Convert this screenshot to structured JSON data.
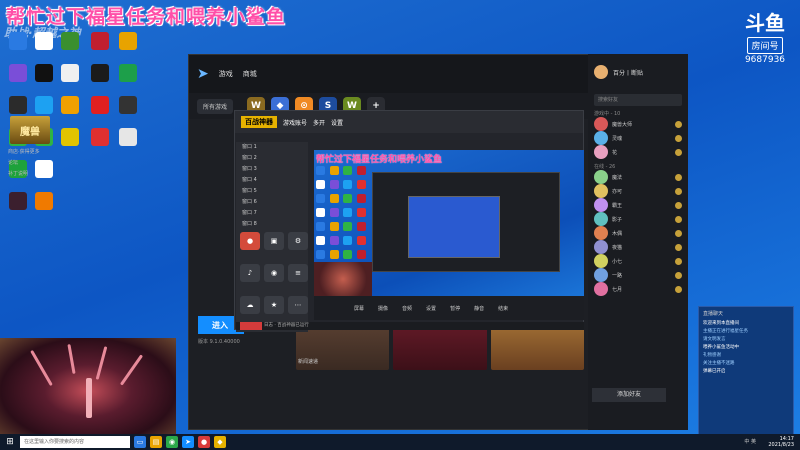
{
  "overlay": {
    "title": "帮忙过下福星任务和喂养小鲨鱼",
    "watermark": "助战·超越之神",
    "platform_logo": "斗鱼",
    "room_label": "房间号",
    "room_number": "9687936"
  },
  "desktop_icons": [
    {
      "name": "icon-1",
      "color": "#2a7ae2"
    },
    {
      "name": "icon-2",
      "color": "#ffffff"
    },
    {
      "name": "icon-3",
      "color": "#3a8f2f"
    },
    {
      "name": "icon-4",
      "color": "#c01f2f"
    },
    {
      "name": "icon-5",
      "color": "#e8a300"
    },
    {
      "name": "icon-6",
      "color": "#7a4ed8"
    },
    {
      "name": "icon-7",
      "color": "#111111"
    },
    {
      "name": "icon-8",
      "color": "#f0f0f0"
    },
    {
      "name": "icon-9",
      "color": "#1b1b1b"
    },
    {
      "name": "icon-10",
      "color": "#1d9f4a"
    },
    {
      "name": "icon-11",
      "color": "#2b2b2b"
    },
    {
      "name": "icon-12",
      "color": "#1da1f2"
    },
    {
      "name": "icon-13",
      "color": "#f0a000"
    },
    {
      "name": "icon-14",
      "color": "#e02020"
    },
    {
      "name": "icon-15",
      "color": "#333333"
    },
    {
      "name": "icon-16",
      "color": "#2fb344"
    },
    {
      "name": "icon-17",
      "color": "#2fb344"
    },
    {
      "name": "icon-18",
      "color": "#e2c400"
    },
    {
      "name": "icon-19",
      "color": "#e03030"
    },
    {
      "name": "icon-20",
      "color": "#e6e6e6"
    },
    {
      "name": "icon-21",
      "color": "#1ea23b"
    },
    {
      "name": "icon-22",
      "color": "#ffffff"
    },
    {
      "name": "icon-23",
      "color": "#b02020"
    },
    {
      "name": "icon-24",
      "color": "#222222"
    },
    {
      "name": "icon-25",
      "color": "#2a7ae2"
    },
    {
      "name": "icon-26",
      "color": "#3b1f2e"
    },
    {
      "name": "icon-27",
      "color": "#f07a00"
    },
    {
      "name": "icon-28",
      "color": "#c02020"
    }
  ],
  "app": {
    "nav_games": "游戏",
    "nav_shop": "商城",
    "all_games": "所有游戏",
    "game_banner": "魔兽",
    "left_links": [
      "商店·获得更多",
      "论坛",
      "补丁说明"
    ],
    "play_button": "进入",
    "play_sub": "版本 9.1.0.40000",
    "thumb_caption": "新闻速递"
  },
  "tool": {
    "brand": "百战神器",
    "tab_bar": [
      "游戏账号",
      "多开",
      "设置"
    ],
    "list_rows": [
      "窗口 1",
      "窗口 2",
      "窗口 3",
      "窗口 4",
      "窗口 5",
      "窗口 6",
      "窗口 7",
      "窗口 8"
    ],
    "grid_label": "工具箱",
    "inner_title": "帮忙过下福星任务和喂养小鲨鱼",
    "controls": [
      "屏幕",
      "摄像",
      "音频",
      "设置",
      "暂停",
      "静音",
      "结束"
    ],
    "status": "日志 · 百战神器已运行"
  },
  "friends": {
    "me_name": "百分丨断贴",
    "search_placeholder": "搜索好友",
    "section_online": "游戏中 - 10",
    "section_recent": "在线 - 26",
    "list": [
      {
        "name": "魔兽大师",
        "color": "#d85858"
      },
      {
        "name": "灵魂",
        "color": "#5ab0e8"
      },
      {
        "name": "花",
        "color": "#e8a0c0"
      },
      {
        "name": "魔法",
        "color": "#8ad08a"
      },
      {
        "name": "亦可",
        "color": "#e0c060"
      },
      {
        "name": "霸王",
        "color": "#c090f0"
      },
      {
        "name": "影子",
        "color": "#60c0c0"
      },
      {
        "name": "木偶",
        "color": "#e08050"
      },
      {
        "name": "夜猫",
        "color": "#9090d0"
      },
      {
        "name": "小七",
        "color": "#d0d060"
      },
      {
        "name": "一路",
        "color": "#70a0e0"
      },
      {
        "name": "七月",
        "color": "#e070a0"
      }
    ],
    "add_button": "添加好友"
  },
  "notify": {
    "header": "直播聊天",
    "lines": [
      {
        "text": "欢迎来到本直播间",
        "white": true
      },
      {
        "text": "主播正在进行福星任务",
        "white": false
      },
      {
        "text": "请文明发言",
        "white": false
      },
      {
        "text": "喂养小鲨鱼活动中",
        "white": true
      },
      {
        "text": "礼物感谢",
        "white": false
      },
      {
        "text": "关注主播不迷路",
        "white": false
      },
      {
        "text": "弹幕已开启",
        "white": true
      }
    ]
  },
  "taskbar": {
    "search_placeholder": "在这里输入你要搜索的内容",
    "tray": "中 英",
    "time": "14:17",
    "date": "2021/8/23"
  }
}
